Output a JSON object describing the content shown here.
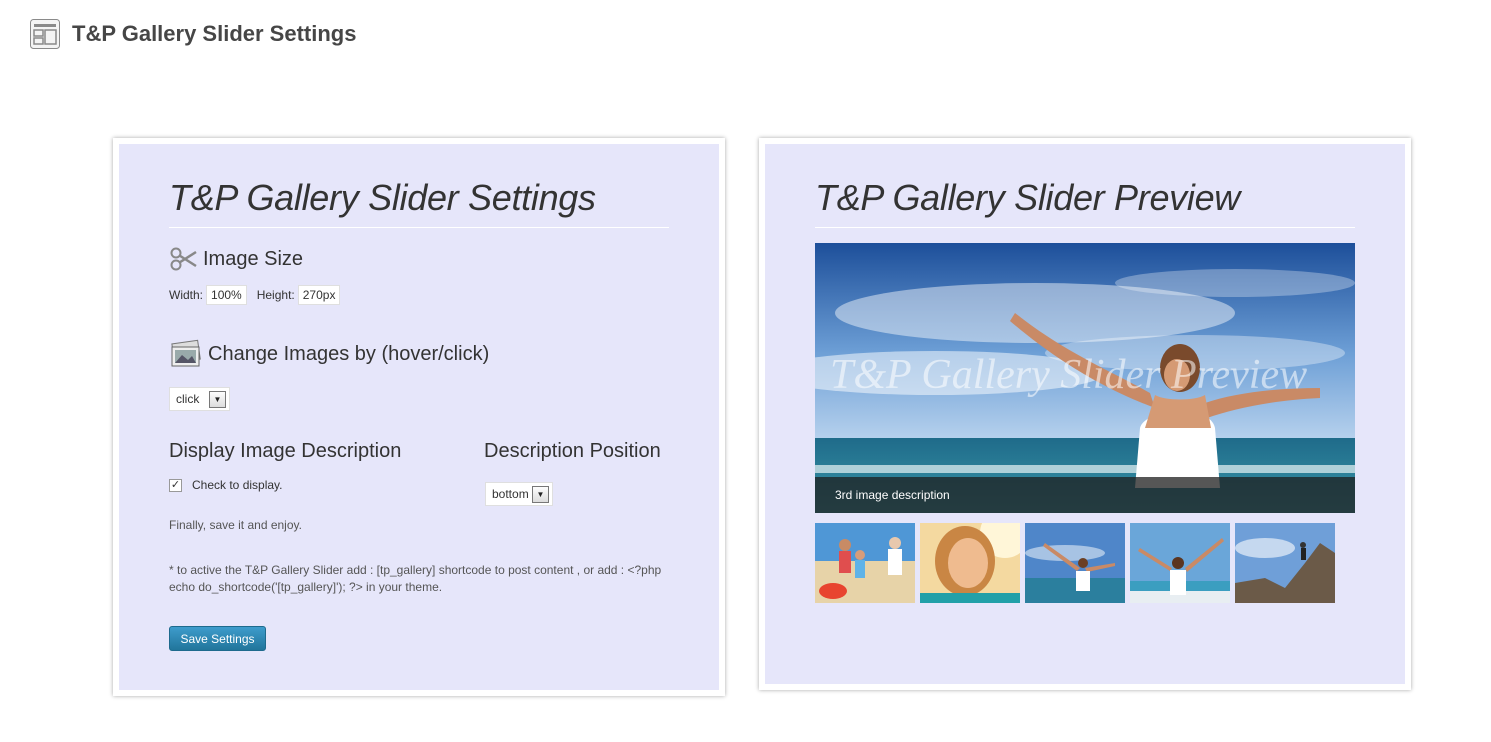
{
  "header": {
    "title": "T&P Gallery Slider Settings",
    "icon": "settings-page-icon"
  },
  "settings": {
    "title": "T&P Gallery Slider Settings",
    "image_size": {
      "heading": "Image Size",
      "width_label": "Width:",
      "width_value": "100%",
      "height_label": "Height:",
      "height_value": "270px"
    },
    "change_images": {
      "heading": "Change Images by (hover/click)",
      "selected": "click"
    },
    "display_description": {
      "heading": "Display Image Description",
      "checkbox_label": "Check to display.",
      "checked": true
    },
    "description_position": {
      "heading": "Description Position",
      "selected": "bottom"
    },
    "finally_note": "Finally, save it and enjoy.",
    "shortcode_note": "* to active the T&P Gallery Slider add : [tp_gallery] shortcode to post content , or add : <?php echo do_shortcode('[tp_gallery]'); ?> in your theme.",
    "save_label": "Save Settings"
  },
  "preview": {
    "title": "T&P Gallery Slider Preview",
    "watermark": "T&P Gallery Slider Preview",
    "caption": "3rd image description",
    "thumbnails": [
      "family-beach-thumb",
      "smiling-woman-thumb",
      "woman-sea-thumb",
      "woman-arms-up-thumb",
      "climber-thumb"
    ]
  },
  "colors": {
    "panel_bg": "#e6e6fa",
    "button": "#21759b"
  }
}
